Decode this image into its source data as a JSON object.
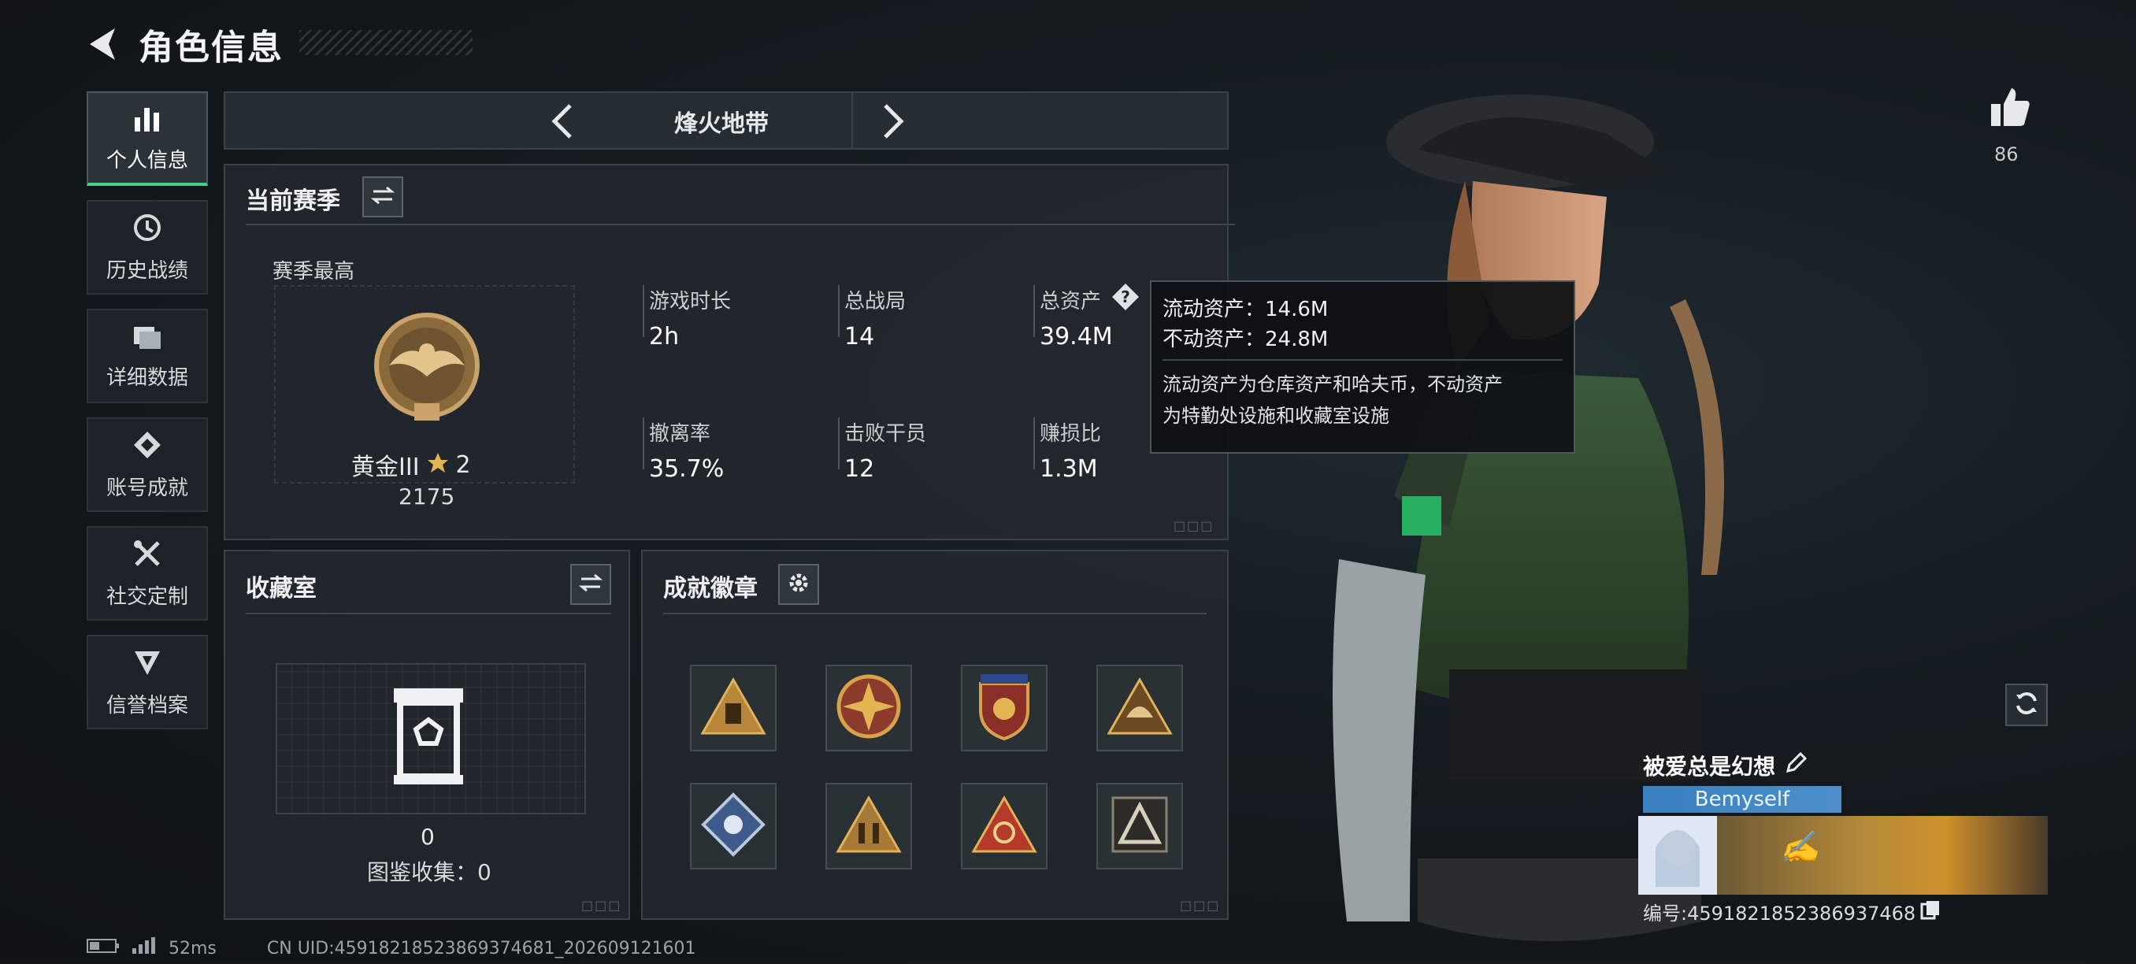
{
  "header": {
    "title": "角色信息"
  },
  "sidebar": {
    "items": [
      {
        "label": "个人信息",
        "icon": "bar-chart-icon",
        "active": true
      },
      {
        "label": "历史战绩",
        "icon": "clock-icon"
      },
      {
        "label": "详细数据",
        "icon": "folder-icon"
      },
      {
        "label": "账号成就",
        "icon": "medal-icon"
      },
      {
        "label": "社交定制",
        "icon": "tools-icon"
      },
      {
        "label": "信誉档案",
        "icon": "shield-icon"
      }
    ]
  },
  "mode_selector": {
    "label": "烽火地带"
  },
  "season": {
    "title": "当前赛季",
    "best_label": "赛季最高",
    "rank_name": "黄金III",
    "rank_stars": "2",
    "rank_score": "2175",
    "stats": [
      {
        "label": "游戏时长",
        "value": "2h"
      },
      {
        "label": "总战局",
        "value": "14"
      },
      {
        "label": "总资产",
        "value": "39.4M"
      },
      {
        "label": "撤离率",
        "value": "35.7%"
      },
      {
        "label": "击败干员",
        "value": "12"
      },
      {
        "label": "赚损比",
        "value": "1.3M"
      }
    ]
  },
  "tooltip": {
    "liquid": "流动资产：14.6M",
    "fixed": "不动资产：24.8M",
    "desc_line1": "流动资产为仓库资产和哈夫币，不动资产",
    "desc_line2": "为特勤处设施和收藏室设施"
  },
  "collection": {
    "title": "收藏室",
    "count": "0",
    "catalog": "图鉴收集：0"
  },
  "achievements": {
    "title": "成就徽章",
    "badges": [
      "triangle-crate-badge",
      "star-compass-badge",
      "shield-star-badge",
      "triangle-helmet-badge",
      "diamond-rose-badge",
      "triangle-soldiers-badge",
      "triangle-target-badge",
      "triangle-peak-badge"
    ]
  },
  "likes": {
    "count": "86"
  },
  "profile": {
    "name": "被爱总是幻想",
    "tag": "Bemyself",
    "id_text": "编号:4591821852386937468"
  },
  "status": {
    "ping": "52ms",
    "uid": "CN UID:45918218523869374681_202609121601"
  },
  "colors": {
    "accent": "#3fd48a",
    "panel": "#22282d",
    "tag_blue": "#3a7fbf"
  }
}
